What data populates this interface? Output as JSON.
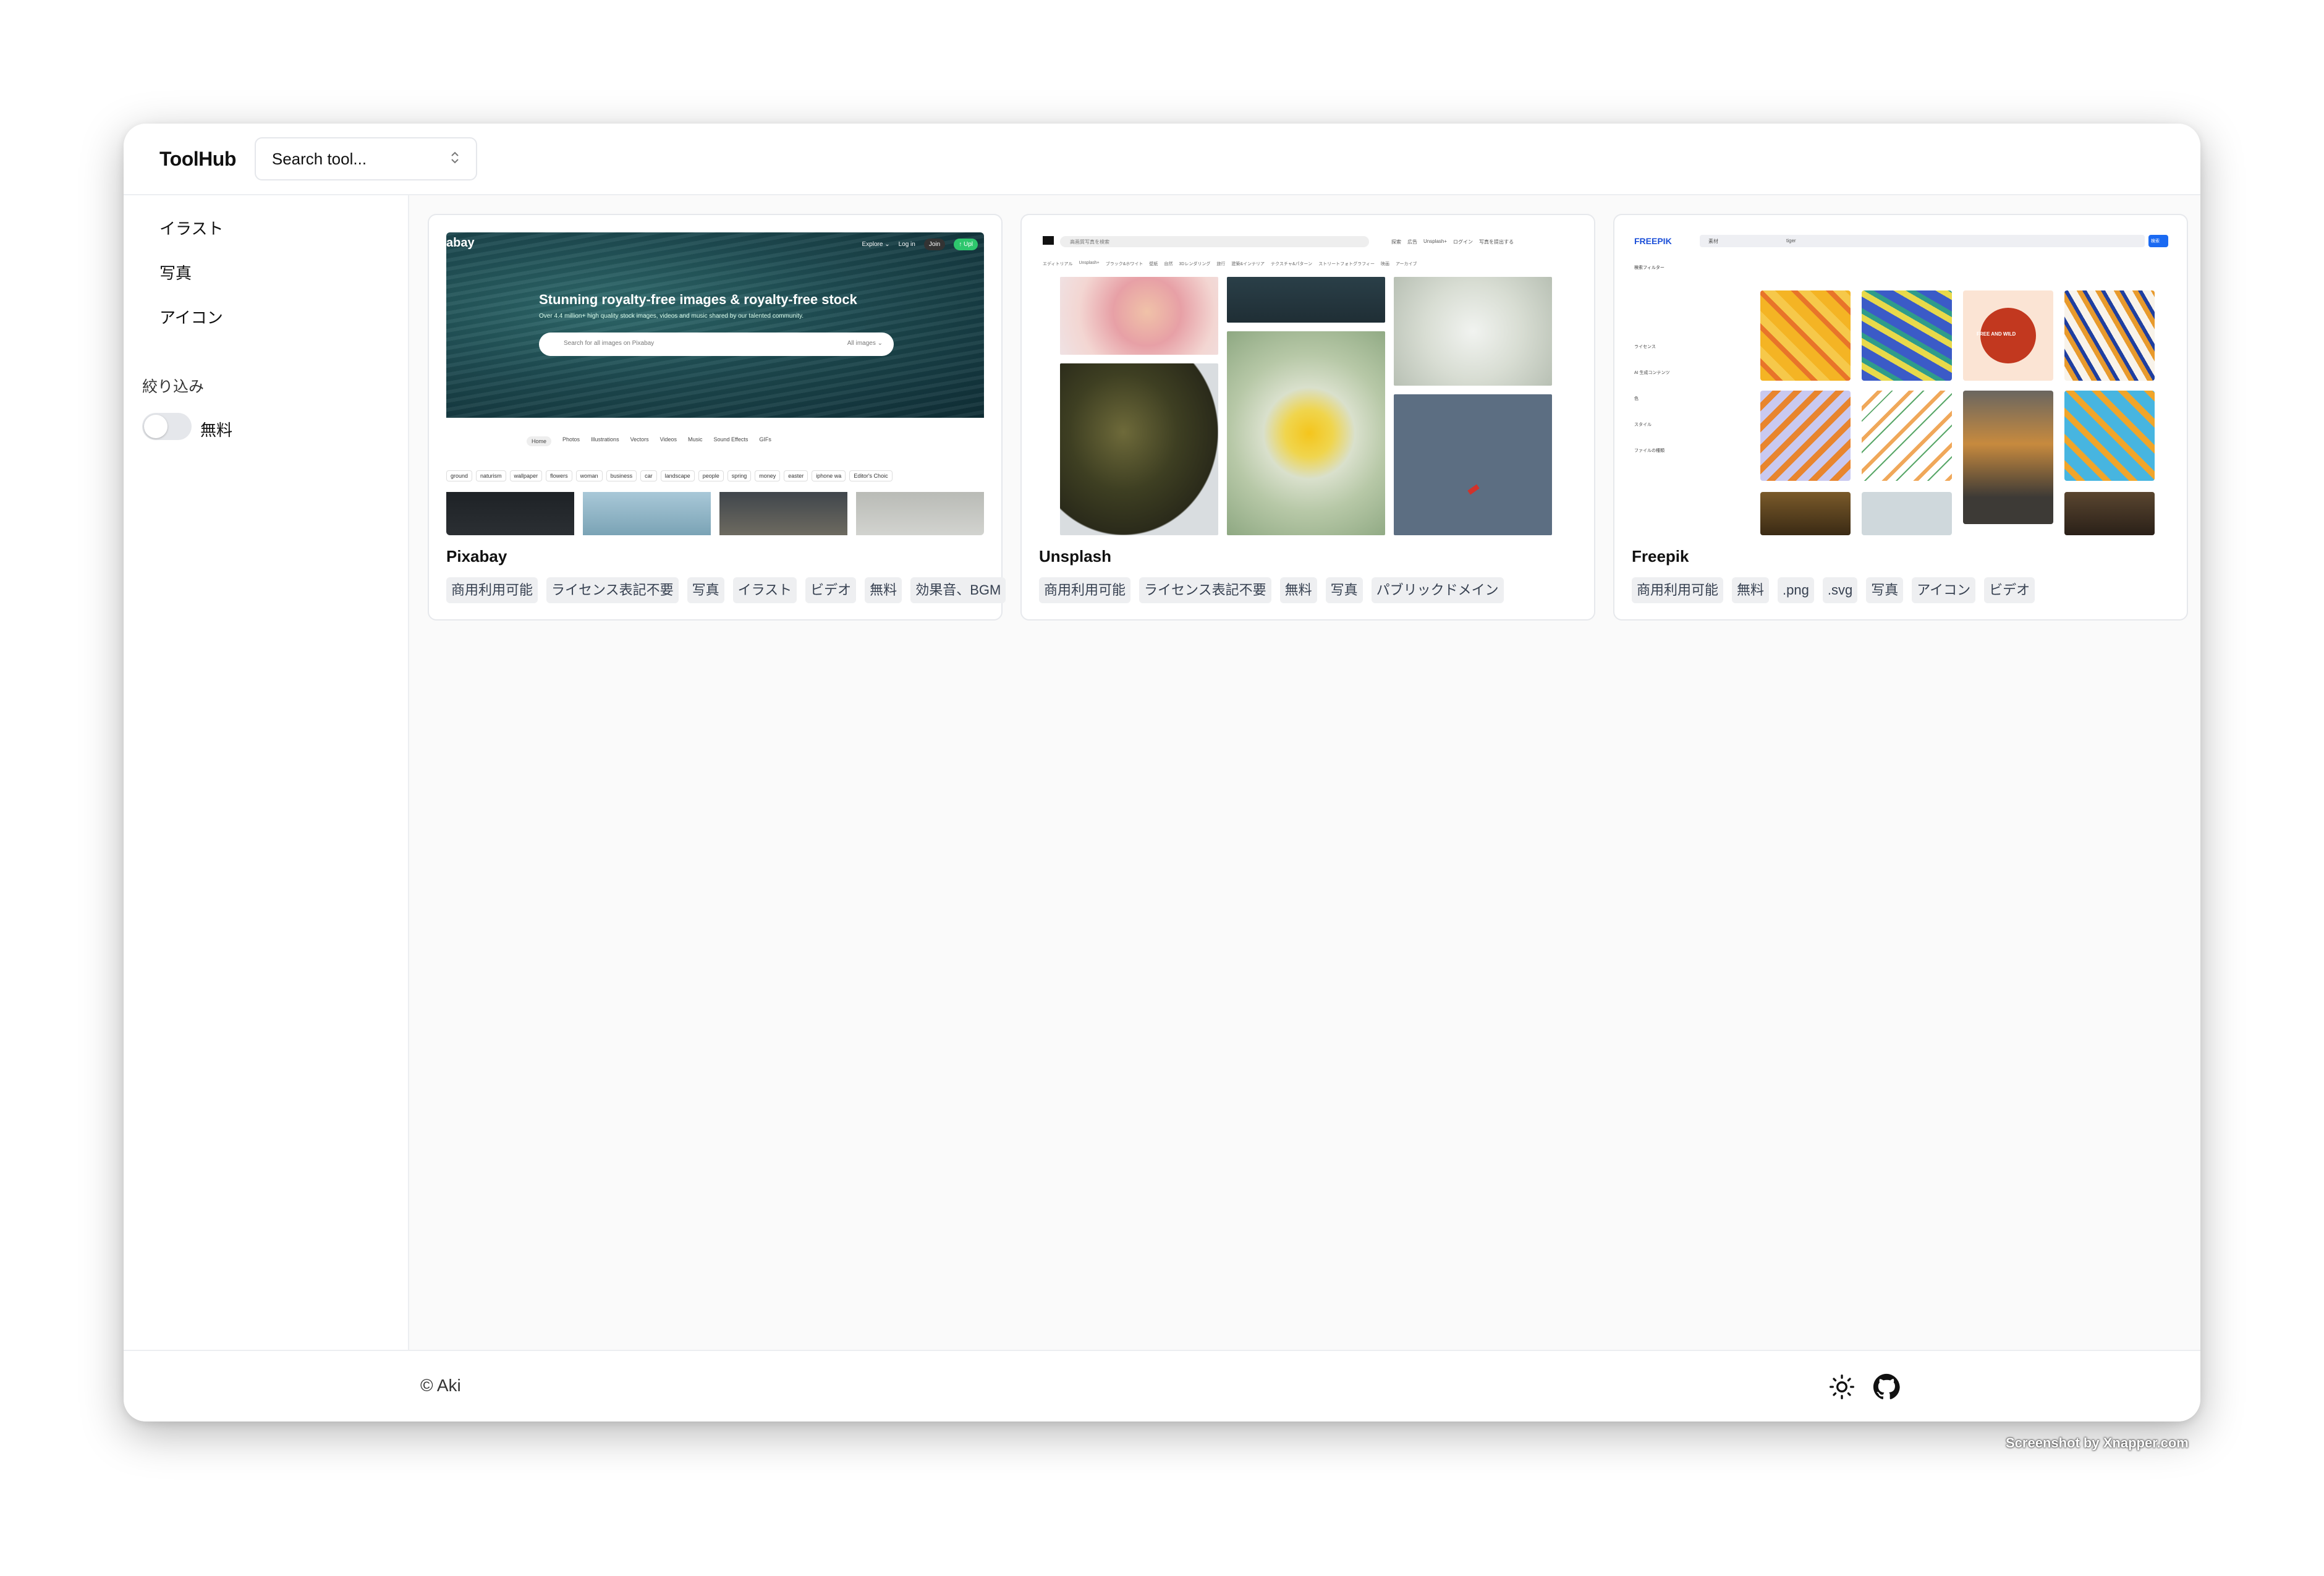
{
  "header": {
    "brand": "ToolHub",
    "search_placeholder": "Search tool...",
    "search_chevron": "⌃⌄"
  },
  "sidebar": {
    "items": [
      {
        "label": "イラスト"
      },
      {
        "label": "写真"
      },
      {
        "label": "アイコン"
      }
    ],
    "filter_title": "絞り込み",
    "toggle": {
      "label": "無料",
      "checked": false
    }
  },
  "cards": [
    {
      "title": "Pixabay",
      "tags": [
        "商用利用可能",
        "ライセンス表記不要",
        "写真",
        "イラスト",
        "ビデオ",
        "無料",
        "効果音、BGM"
      ],
      "preview": {
        "logo": "abay",
        "nav": [
          "Explore ⌄",
          "Log in",
          "Join",
          "↑ Upl"
        ],
        "headline": "Stunning royalty-free images & royalty-free stock",
        "sub": "Over 4.4 million+ high quality stock images, videos and music shared by our talented community.",
        "search": "Search for all images on Pixabay",
        "search_scope": "All images ⌄",
        "tabs": [
          "Home",
          "Photos",
          "Illustrations",
          "Vectors",
          "Videos",
          "Music",
          "Sound Effects",
          "GIFs"
        ],
        "chips": [
          "ground",
          "naturism",
          "wallpaper",
          "flowers",
          "woman",
          "business",
          "car",
          "landscape",
          "people",
          "spring",
          "money",
          "easter",
          "iphone wa"
        ],
        "chip_extra": "Editor's Choic"
      }
    },
    {
      "title": "Unsplash",
      "tags": [
        "商用利用可能",
        "ライセンス表記不要",
        "無料",
        "写真",
        "パブリックドメイン"
      ],
      "preview": {
        "search": "高画質写真を検索",
        "nav": [
          "探索",
          "広告",
          "Unsplash+",
          "ログイン",
          "写真を提出する"
        ],
        "cats": [
          "エディトリアル",
          "Unsplash+",
          "ブラック&ホワイト",
          "壁紙",
          "自然",
          "3Dレンダリング",
          "旅行",
          "建築&インテリア",
          "テクスチャ&パターン",
          "ストリートフォトグラフィー",
          "映画",
          "アーカイブ"
        ]
      }
    },
    {
      "title": "Freepik",
      "tags": [
        "商用利用可能",
        "無料",
        ".png",
        ".svg",
        "写真",
        "アイコン",
        "ビデオ"
      ],
      "preview": {
        "logo": "FREEPIK",
        "scope": "素材",
        "query": "tiger",
        "search_button": "検索",
        "filter_title": "検索フィルター",
        "filters": [
          "ライセンス",
          "AI 生成コンテンツ",
          "色",
          "スタイル",
          "ファイルの種類"
        ],
        "badge": "FREE AND WILD"
      }
    }
  ],
  "footer": {
    "copyright": "© Aki"
  },
  "credit": "Screenshot by Xnapper.com"
}
